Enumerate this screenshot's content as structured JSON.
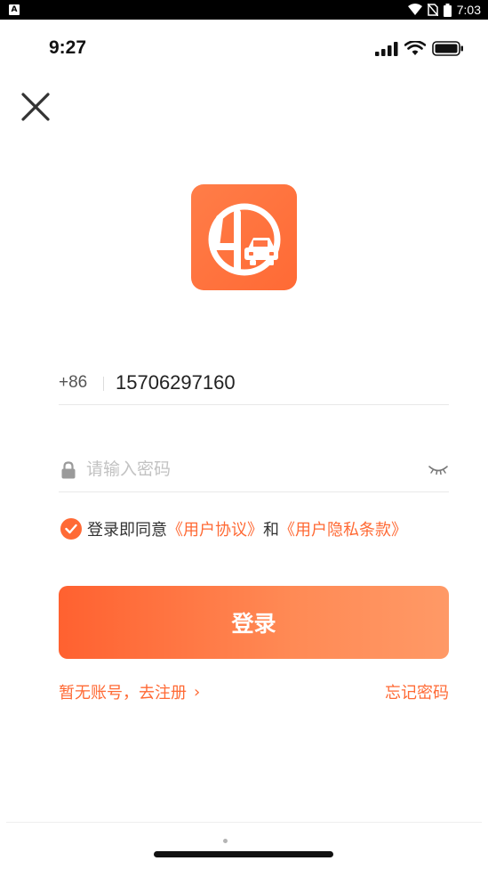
{
  "android_status": {
    "left_icon_label": "A",
    "time": "7:03"
  },
  "ios_status": {
    "time": "9:27"
  },
  "login": {
    "country_code": "+86",
    "phone_value": "15706297160",
    "password_placeholder": "请输入密码",
    "agreement": {
      "prefix": "登录即同意",
      "user_agreement": "《用户协议》",
      "and": "和",
      "privacy_policy": "《用户隐私条款》",
      "checked": true
    },
    "login_label": "登录",
    "register_label": "暂无账号，去注册",
    "register_chevron": "›",
    "forgot_label": "忘记密码"
  },
  "colors": {
    "accent": "#ff6a35",
    "button_start": "#ff6130",
    "button_end": "#ff9966"
  },
  "icons": {
    "close": "close-icon",
    "app_logo": "app-logo",
    "lock": "lock-icon",
    "eye": "eye-closed-icon",
    "check": "check-icon"
  }
}
